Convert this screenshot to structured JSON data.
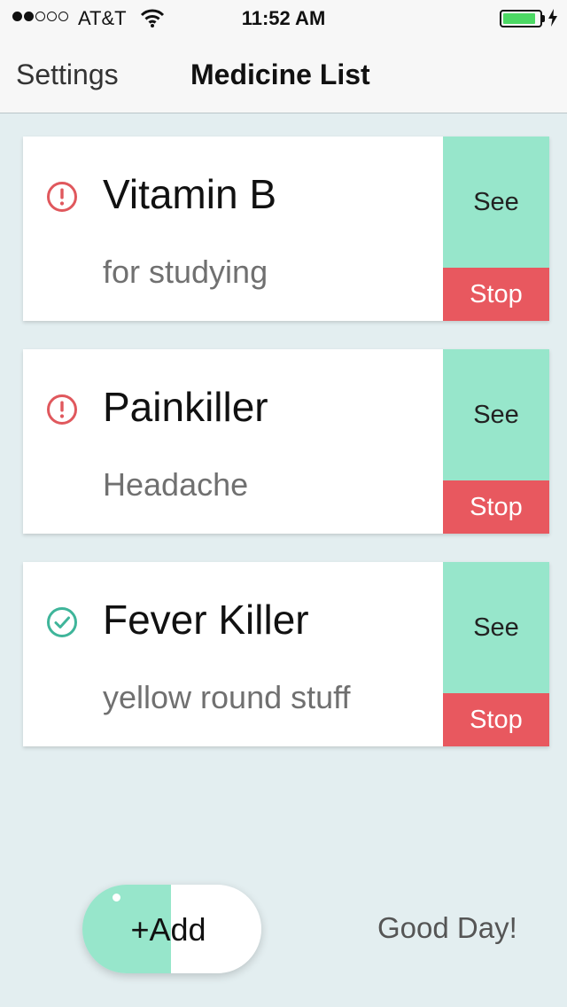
{
  "status_bar": {
    "carrier": "AT&T",
    "time": "11:52 AM",
    "battery_level": 0.9
  },
  "nav": {
    "left_button": "Settings",
    "title": "Medicine List"
  },
  "medicines": [
    {
      "name": "Vitamin B",
      "description": "for studying",
      "status_icon": "alert-circle-icon",
      "status_color": "#e0585d",
      "see_label": "See",
      "stop_label": "Stop"
    },
    {
      "name": "Painkiller",
      "description": "Headache",
      "status_icon": "alert-circle-icon",
      "status_color": "#e0585d",
      "see_label": "See",
      "stop_label": "Stop"
    },
    {
      "name": "Fever Killer",
      "description": "yellow round stuff",
      "status_icon": "check-circle-icon",
      "status_color": "#3fb59a",
      "see_label": "See",
      "stop_label": "Stop"
    }
  ],
  "footer": {
    "add_label": "+Add",
    "greeting": "Good Day!"
  },
  "colors": {
    "background": "#e3eef0",
    "see_button": "#97e6cb",
    "stop_button": "#e8585f",
    "alert": "#e0585d",
    "ok": "#3fb59a"
  }
}
